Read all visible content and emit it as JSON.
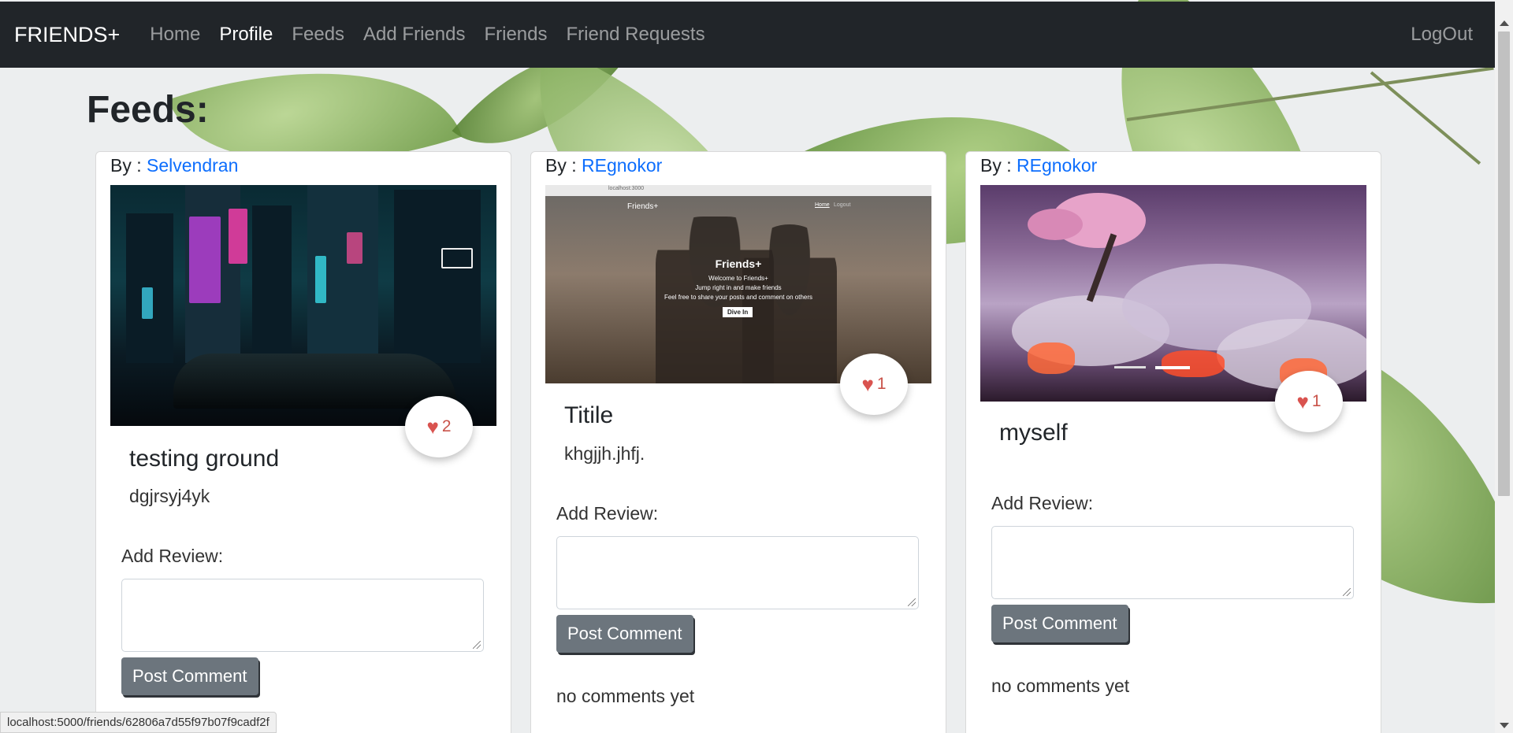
{
  "navbar": {
    "brand": "FRIENDS+",
    "links": [
      "Home",
      "Profile",
      "Feeds",
      "Add Friends",
      "Friends",
      "Friend Requests"
    ],
    "active": "Profile",
    "logout": "LogOut"
  },
  "page_title": "Feeds:",
  "posts": [
    {
      "by_label": "By :",
      "author": "Selvendran",
      "likes": "2",
      "title": "testing ground",
      "text": "dgjrsyj4yk",
      "review_label": "Add Review:",
      "button": "Post Comment",
      "comments": ""
    },
    {
      "by_label": "By :",
      "author": "REgnokor",
      "likes": "1",
      "title": "Titile",
      "text": "khgjjh.jhfj.",
      "review_label": "Add Review:",
      "button": "Post Comment",
      "comments": "no comments yet",
      "image_text": {
        "brand": "Friends+",
        "nav_home": "Home",
        "nav_logout": "Logout",
        "headline": "Friends+",
        "line1": "Welcome to Friends+",
        "line2": "Jump right in and make friends",
        "line3": "Feel free to share your posts and comment on others",
        "button": "Dive In",
        "url": "localhost:3000"
      }
    },
    {
      "by_label": "By :",
      "author": "REgnokor",
      "likes": "1",
      "title": "myself",
      "text": "",
      "review_label": "Add Review:",
      "button": "Post Comment",
      "comments": "no comments yet"
    }
  ],
  "status_bar": "localhost:5000/friends/62806a7d55f97b07f9cadf2f",
  "colors": {
    "navbar": "#212529",
    "link": "#0d6efd",
    "button": "#6c757d",
    "heart": "#d9534f"
  }
}
